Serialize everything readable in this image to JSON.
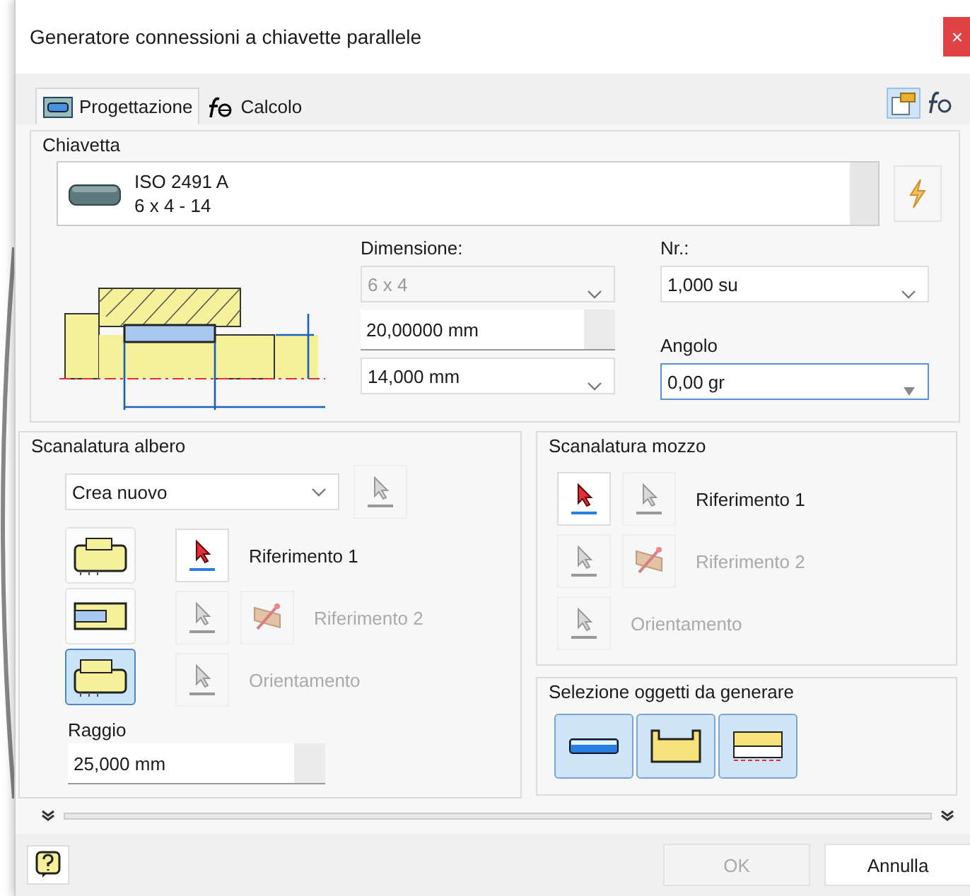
{
  "window": {
    "title": "Generatore connessioni a chiavette parallele",
    "close": "×"
  },
  "tabs": [
    {
      "label": "Progettazione",
      "selected": true
    },
    {
      "label": "Calcolo",
      "selected": false
    }
  ],
  "chiavetta": {
    "title": "Chiavetta",
    "key_name": "ISO 2491 A",
    "key_size": "6 x 4 - 14",
    "dimension": {
      "label": "Dimensione:",
      "value": "6 x 4",
      "disabled": true
    },
    "shaft_diameter": {
      "value": "20,00000 mm"
    },
    "key_length": {
      "value": "14,000 mm"
    },
    "count": {
      "label": "Nr.:",
      "value": "1,000 su"
    },
    "angle": {
      "label": "Angolo",
      "value": "0,00 gr",
      "focused": true
    }
  },
  "shaft_groove": {
    "title": "Scanalatura albero",
    "mode": "Crea nuovo",
    "groove_types": [
      {
        "kind": "closed",
        "selected": false
      },
      {
        "kind": "open",
        "selected": false
      },
      {
        "kind": "end",
        "selected": true
      }
    ],
    "references": [
      {
        "label": "Riferimento 1",
        "disabled": false,
        "buttons": [
          {
            "kind": "pick",
            "active": true
          }
        ]
      },
      {
        "label": "Riferimento 2",
        "disabled": true,
        "buttons": [
          {
            "kind": "pick",
            "active": false
          },
          {
            "kind": "flip",
            "active": false
          }
        ]
      },
      {
        "label": "Orientamento",
        "disabled": true,
        "buttons": [
          {
            "kind": "pick",
            "active": false
          }
        ]
      }
    ],
    "radius": {
      "label": "Raggio",
      "value": "25,000 mm"
    }
  },
  "hub_groove": {
    "title": "Scanalatura mozzo",
    "references": [
      {
        "label": "Riferimento 1",
        "disabled": false,
        "buttons": [
          {
            "kind": "pick",
            "active": true
          },
          {
            "kind": "pick",
            "active": false
          }
        ]
      },
      {
        "label": "Riferimento 2",
        "disabled": true,
        "buttons": [
          {
            "kind": "pick",
            "active": false
          },
          {
            "kind": "flip",
            "active": false
          }
        ]
      },
      {
        "label": "Orientamento",
        "disabled": true,
        "buttons": [
          {
            "kind": "pick",
            "active": false
          }
        ]
      }
    ]
  },
  "generate": {
    "title": "Selezione oggetti da generare",
    "objects": [
      {
        "kind": "key",
        "selected": true
      },
      {
        "kind": "shaft",
        "selected": true
      },
      {
        "kind": "hub",
        "selected": true
      }
    ]
  },
  "footer": {
    "buttons": [
      {
        "label": "OK",
        "disabled": true
      },
      {
        "label": "Annulla",
        "disabled": false
      }
    ]
  }
}
